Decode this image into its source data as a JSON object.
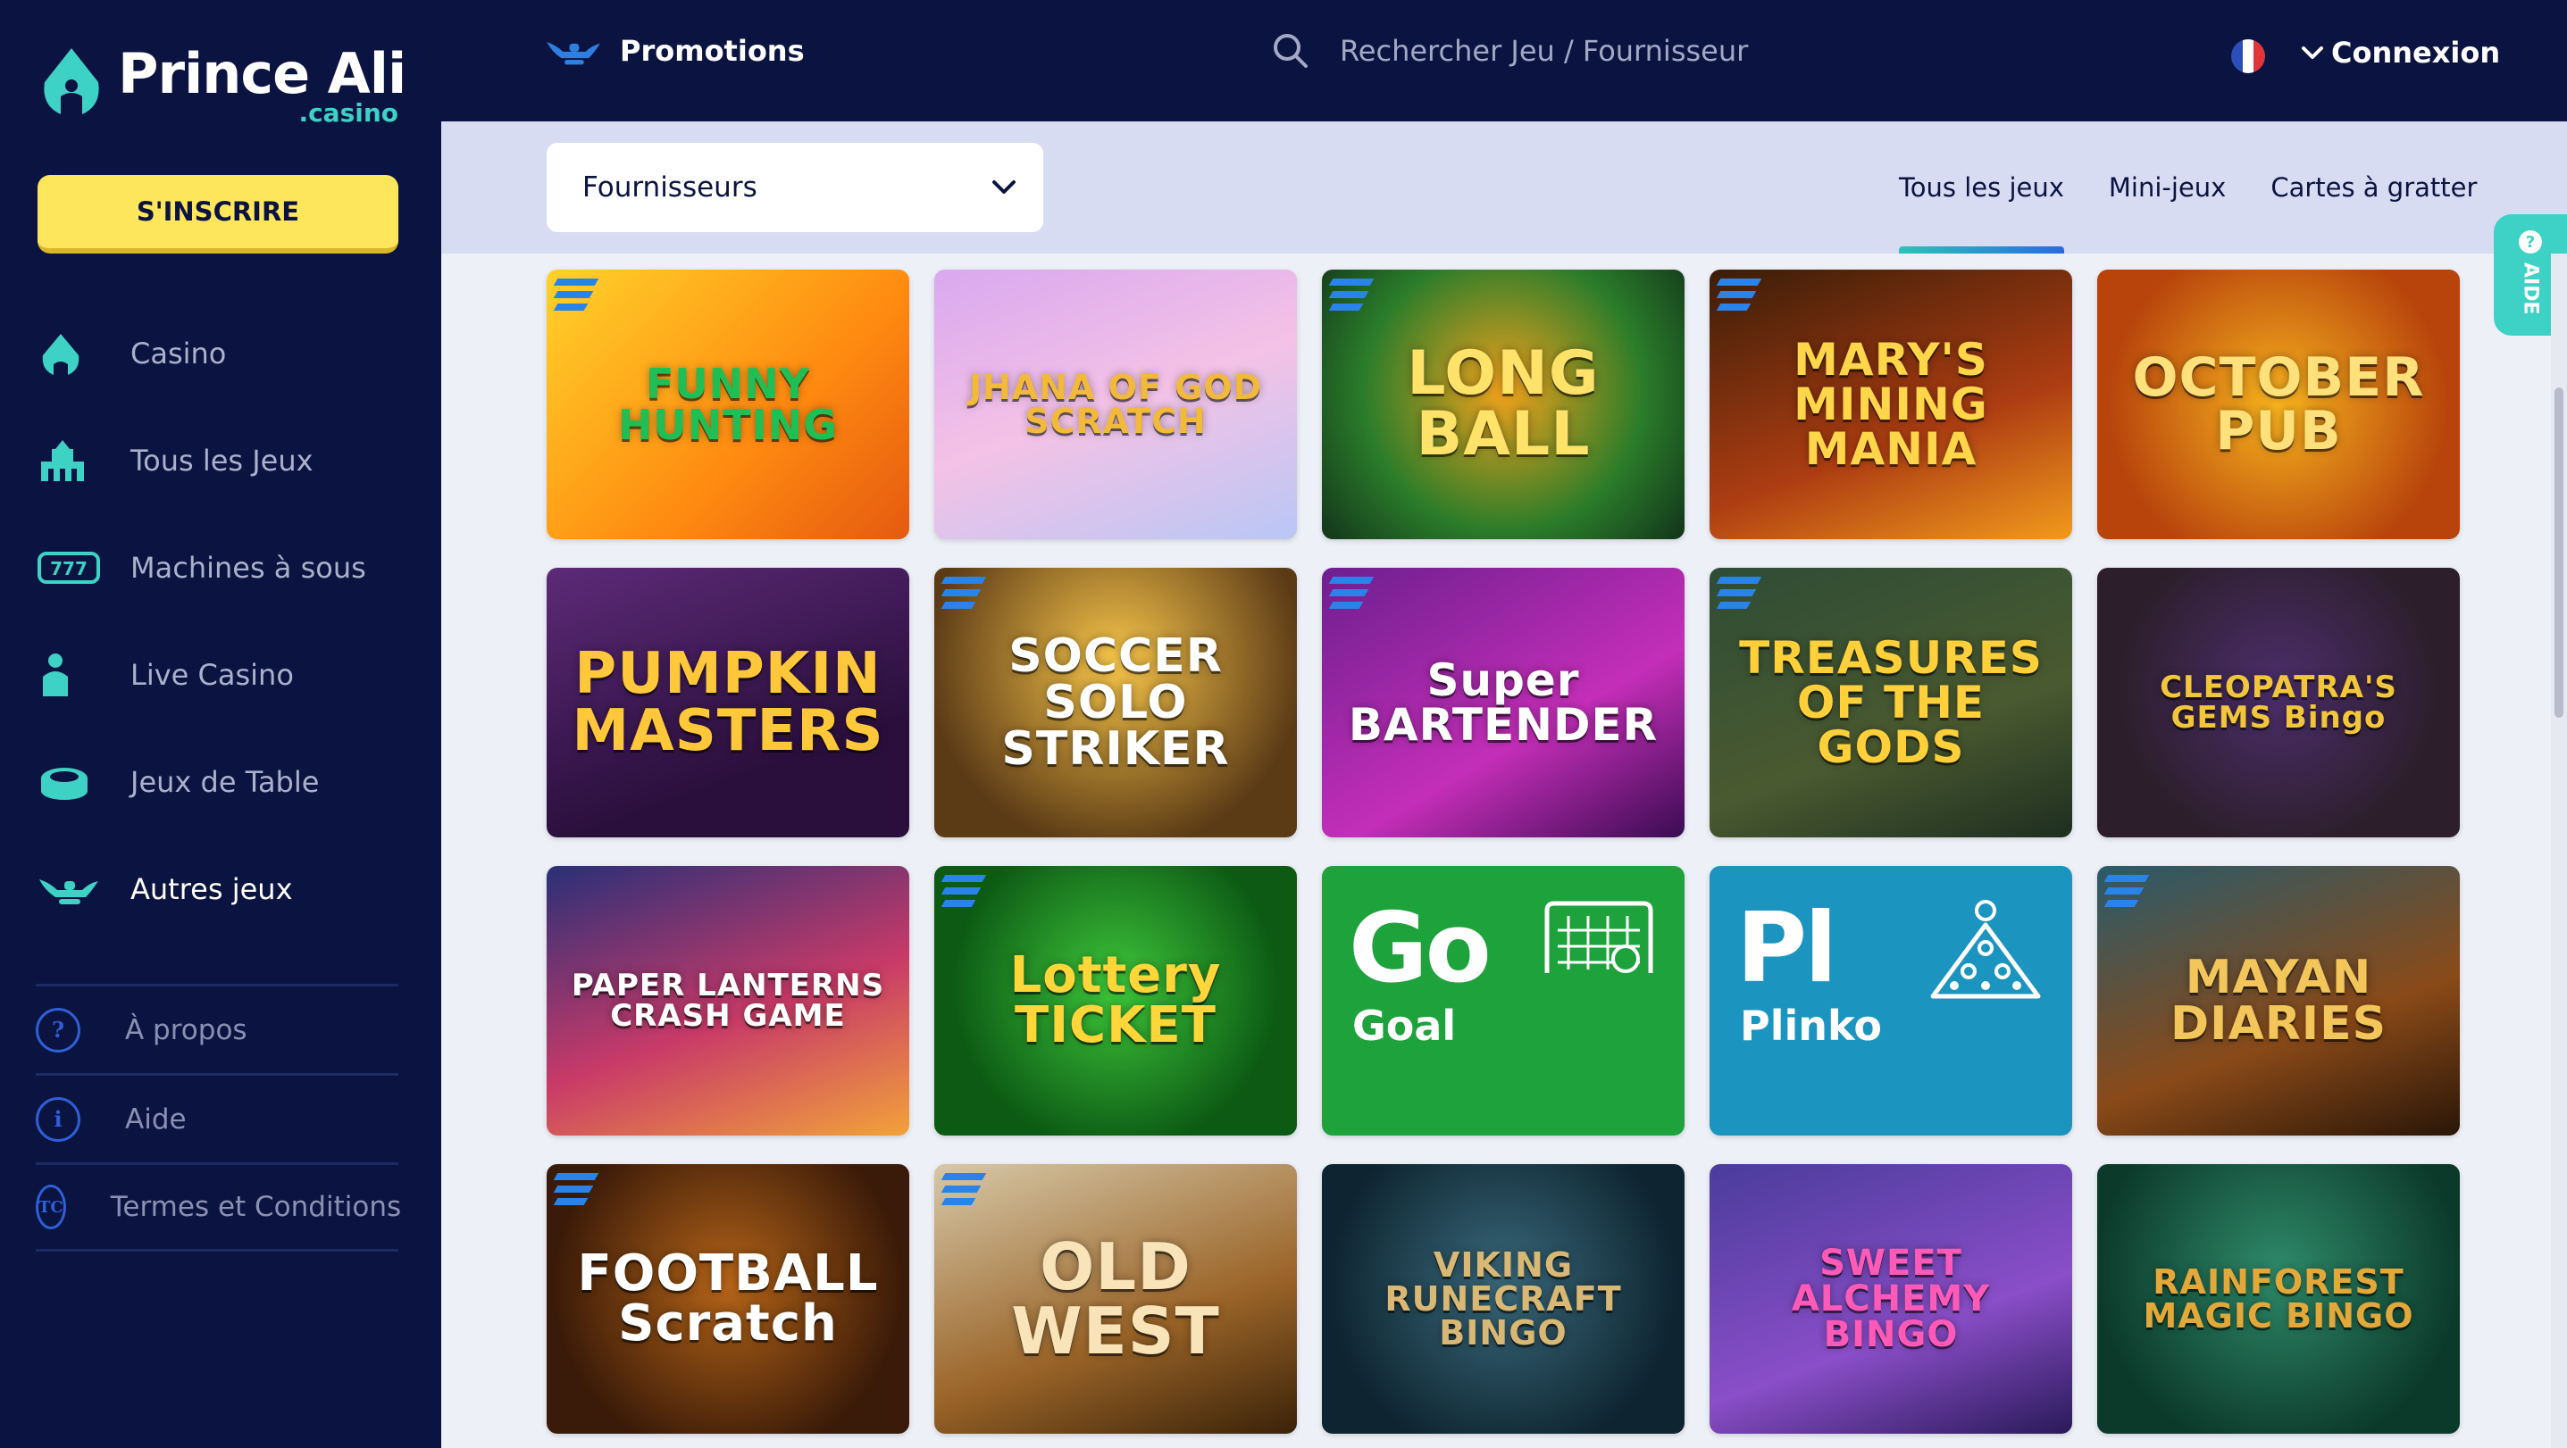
{
  "brand": {
    "name": "Prince Ali",
    "sub": ".casino"
  },
  "sidebar": {
    "signup_label": "S'INSCRIRE",
    "items": [
      {
        "label": "Casino",
        "icon": "casino-icon"
      },
      {
        "label": "Tous les Jeux",
        "icon": "all-games-icon"
      },
      {
        "label": "Machines à sous",
        "icon": "slot-machine-icon"
      },
      {
        "label": "Live Casino",
        "icon": "live-dealer-icon"
      },
      {
        "label": "Jeux de Table",
        "icon": "table-games-icon"
      },
      {
        "label": "Autres jeux",
        "icon": "genie-lamp-icon",
        "active": true
      }
    ],
    "footer": [
      {
        "label": "À propos",
        "glyph": "?"
      },
      {
        "label": "Aide",
        "glyph": "i"
      },
      {
        "label": "Termes et Conditions",
        "glyph": "TC"
      }
    ]
  },
  "header": {
    "promotions_label": "Promotions",
    "search_placeholder": "Rechercher Jeu / Fournisseur",
    "login_label": "Connexion"
  },
  "filters": {
    "provider_label": "Fournisseurs",
    "tabs": [
      {
        "label": "Tous les jeux",
        "active": true
      },
      {
        "label": "Mini-jeux"
      },
      {
        "label": "Cartes à gratter"
      }
    ]
  },
  "help": {
    "label": "AIDE"
  },
  "games": [
    {
      "title": "FUNNY HUNTING",
      "bg": "linear-gradient(135deg,#ffd22a,#ff8a10 60%,#e45a10)",
      "color": "#1fbf56",
      "size": 46,
      "badge": true
    },
    {
      "title": "JHANA OF GOD SCRATCH",
      "bg": "linear-gradient(160deg,#d9a8ef,#f4c2e6 50%,#b9c7f5)",
      "color": "#f2b93a",
      "size": 38,
      "badge": false
    },
    {
      "title": "LONG BALL",
      "bg": "radial-gradient(circle at 50% 45%,#f1a21c,#2a7c2a 60%,#12341a)",
      "color": "#ffe26a",
      "size": 68,
      "badge": true
    },
    {
      "title": "MARY'S MINING MANIA",
      "bg": "linear-gradient(160deg,#3a1d08,#ad3d12 60%,#f29a1c)",
      "color": "#ffd54a",
      "size": 50,
      "badge": true
    },
    {
      "title": "OCTOBER PUB",
      "bg": "radial-gradient(circle at 50% 50%,#f6b31e,#b8440c 75%)",
      "color": "#ffe07a",
      "size": 60,
      "badge": false
    },
    {
      "title": "PUMPKIN MASTERS",
      "bg": "linear-gradient(160deg,#5d2a78,#2a0f3c 70%)",
      "color": "#ffc83a",
      "size": 64,
      "badge": false
    },
    {
      "title": "SOCCER SOLO STRIKER",
      "bg": "radial-gradient(circle at 50% 35%,#f7c54a,#5b3a16 75%)",
      "color": "#ffffff",
      "size": 52,
      "badge": true
    },
    {
      "title": "Super BARTENDER",
      "bg": "linear-gradient(150deg,#6c1f8f,#c42eb8 60%,#3a0c52)",
      "color": "#ffffff",
      "size": 50,
      "badge": true
    },
    {
      "title": "TREASURES OF THE GODS",
      "bg": "linear-gradient(160deg,#2e4c36,#4a5a30 60%,#1e2e20)",
      "color": "#ffd03a",
      "size": 50,
      "badge": true
    },
    {
      "title": "CLEOPATRA'S GEMS Bingo",
      "bg": "radial-gradient(circle at 50% 45%,#4c2e6c,#2c1e2a 70%)",
      "color": "#f2c63a",
      "size": 34,
      "badge": false
    },
    {
      "title": "PAPER LANTERNS CRASH GAME",
      "bg": "linear-gradient(160deg,#2a2f78,#c83a68 55%,#f2a23a)",
      "color": "#ffffff",
      "size": 34,
      "badge": false
    },
    {
      "title": "Lottery TICKET",
      "bg": "radial-gradient(circle at 50% 45%,#3ec73a,#0c5a14 70%)",
      "color": "#ffd63a",
      "size": 56,
      "badge": true
    },
    {
      "title": "MAYAN DIARIES",
      "bg": "linear-gradient(160deg,#2a5a6a,#8a4a18 60%,#2a1608)",
      "color": "#f2c65a",
      "size": 52,
      "badge": true
    },
    {
      "title": "FOOTBALL Scratch",
      "bg": "radial-gradient(circle at 50% 45%,#b46418,#3a1a08 75%)",
      "color": "#ffffff",
      "size": 56,
      "badge": true
    },
    {
      "title": "OLD WEST",
      "bg": "linear-gradient(160deg,#d6c8a8,#9a6428 60%,#3a2208)",
      "color": "#f8e4b8",
      "size": 72,
      "badge": true
    },
    {
      "title": "VIKING RUNECRAFT BINGO",
      "bg": "radial-gradient(circle at 50% 45%,#3a6a7c,#0e2430 75%)",
      "color": "#d8b874",
      "size": 38,
      "badge": false
    },
    {
      "title": "SWEET ALCHEMY BINGO",
      "bg": "linear-gradient(160deg,#4a3c9c,#8a4ec8 60%,#2a1a5a)",
      "color": "#ff5ab8",
      "size": 40,
      "badge": false
    },
    {
      "title": "RAINFOREST MAGIC BINGO",
      "bg": "radial-gradient(circle at 50% 40%,#2e8a6a,#0c3a2a 75%)",
      "color": "#e2a83a",
      "size": 38,
      "badge": false
    }
  ],
  "mini_games": [
    {
      "abbr": "Go",
      "name": "Goal",
      "bg": "#1ea23c",
      "icon": "goal-net-icon"
    },
    {
      "abbr": "Pl",
      "name": "Plinko",
      "bg": "#1b95bf",
      "icon": "plinko-triangle-icon"
    }
  ]
}
